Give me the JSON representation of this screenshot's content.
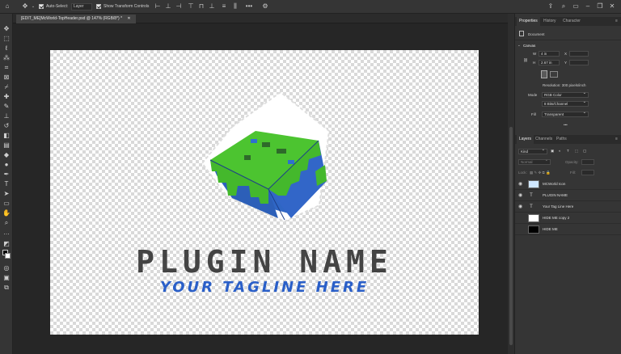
{
  "options_bar": {
    "auto_select_label": "Auto-Select:",
    "auto_select_target": "Layer",
    "show_transform_label": "Show Transform Controls",
    "more_label": "•••"
  },
  "document": {
    "tab_title": "[EDIT_ME]McWorld-TopHeader.psd @ 147% (RGB/8*) *",
    "canvas": {
      "plugin_name": "PLUGIN NAME",
      "tagline": "YOUR TAGLINE HERE"
    }
  },
  "properties_panel": {
    "tabs": [
      "Properties",
      "History",
      "Character"
    ],
    "document_label": "Document",
    "canvas_section": "Canvas",
    "width_label": "W",
    "width_value": "4 in",
    "x_label": "X",
    "height_label": "H",
    "height_value": "2.67 in",
    "y_label": "Y",
    "resolution": "Resolution: 300 pixels/inch",
    "mode_label": "Mode",
    "mode_value": "RGB Color",
    "depth_value": "8 Bits/Channel",
    "fill_label": "Fill",
    "fill_value": "Transparent"
  },
  "layers_panel": {
    "tabs": [
      "Layers",
      "Channels",
      "Paths"
    ],
    "kind_filter": "Kind",
    "blend_mode": "Normal",
    "opacity_label": "Opacity:",
    "lock_label": "Lock:",
    "fill_label": "Fill:",
    "layers": [
      {
        "name": "MCWorld Icon",
        "visible": true,
        "type": "image"
      },
      {
        "name": "PLUGIN NAME",
        "visible": true,
        "type": "text"
      },
      {
        "name": "Your Tag Line Here",
        "visible": true,
        "type": "text"
      },
      {
        "name": "HIDE ME copy 2",
        "visible": false,
        "type": "white"
      },
      {
        "name": "HIDE ME",
        "visible": false,
        "type": "black"
      }
    ]
  },
  "colors": {
    "panel_bg": "#353535",
    "workspace_bg": "#262626",
    "plugin_name_color": "#444444",
    "tagline_color": "#2a5fc8",
    "cube_green": "#4cc430",
    "cube_blue": "#2f6fd0"
  }
}
